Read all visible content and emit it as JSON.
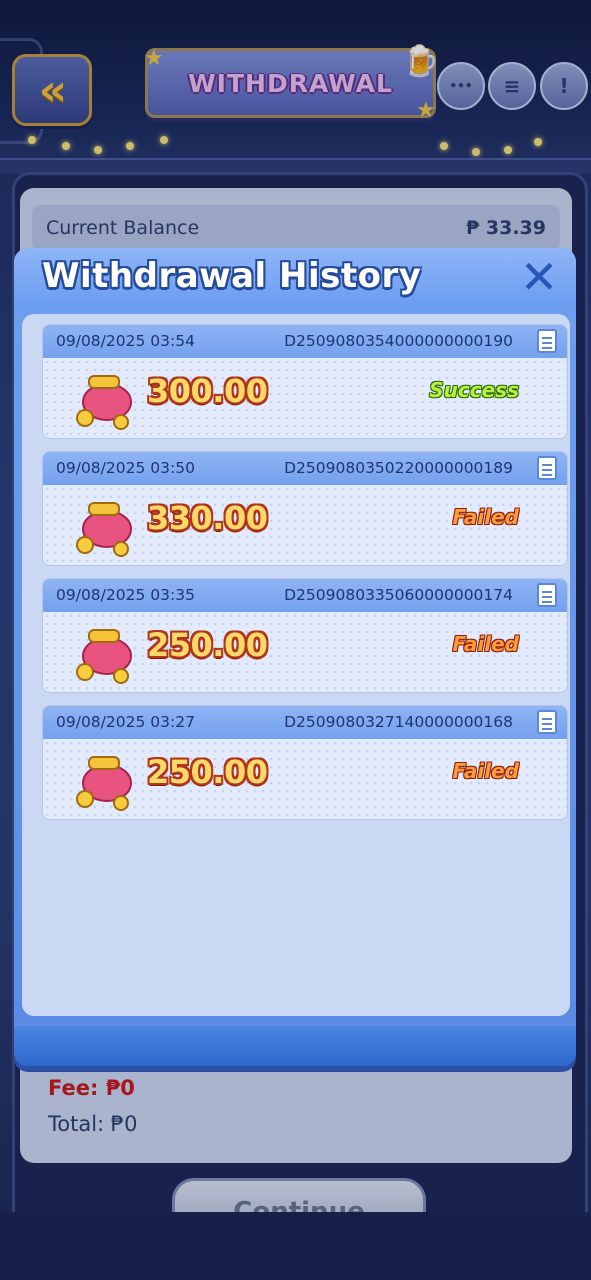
{
  "header": {
    "title": "WITHDRAWAL",
    "back_label": "«",
    "actions": [
      {
        "name": "chat-icon",
        "glyph": "•••"
      },
      {
        "name": "notes-icon",
        "glyph": "≡"
      },
      {
        "name": "alert-icon",
        "glyph": "!"
      }
    ]
  },
  "balance": {
    "label": "Current Balance",
    "value": "₱ 33.39"
  },
  "summary": {
    "fee": "Fee: ₱0",
    "total": "Total: ₱0"
  },
  "continue_label": "Continue",
  "modal": {
    "title": "Withdrawal History",
    "close_glyph": "✕",
    "records": [
      {
        "date": "09/08/2025 03:54",
        "id": "D2509080354000000000190",
        "amount": "300.00",
        "status": "Success",
        "status_type": "success"
      },
      {
        "date": "09/08/2025 03:50",
        "id": "D2509080350220000000189",
        "amount": "330.00",
        "status": "Failed",
        "status_type": "failed"
      },
      {
        "date": "09/08/2025 03:35",
        "id": "D2509080335060000000174",
        "amount": "250.00",
        "status": "Failed",
        "status_type": "failed"
      },
      {
        "date": "09/08/2025 03:27",
        "id": "D2509080327140000000168",
        "amount": "250.00",
        "status": "Failed",
        "status_type": "failed"
      }
    ]
  },
  "colors": {
    "success": "#b8f03a",
    "failed": "#ff9b3a",
    "amount": "#ffd86a",
    "fee": "#c41a1a"
  }
}
